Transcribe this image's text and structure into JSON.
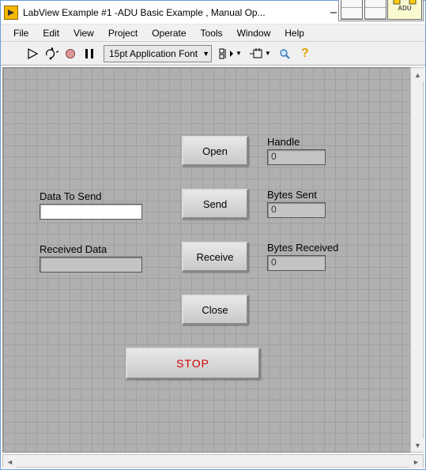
{
  "window": {
    "title": "LabView Example #1 -ADU Basic Example , Manual Op..."
  },
  "menu": {
    "file": "File",
    "edit": "Edit",
    "view": "View",
    "project": "Project",
    "operate": "Operate",
    "tools": "Tools",
    "window": "Window",
    "help": "Help"
  },
  "toolbar": {
    "font": "15pt Application Font"
  },
  "panel": {
    "data_to_send_label": "Data To Send",
    "data_to_send_value": "",
    "received_data_label": "Received Data",
    "received_data_value": "",
    "handle_label": "Handle",
    "handle_value": "0",
    "bytes_sent_label": "Bytes Sent",
    "bytes_sent_value": "0",
    "bytes_received_label": "Bytes Received",
    "bytes_received_value": "0",
    "open_btn": "Open",
    "send_btn": "Send",
    "receive_btn": "Receive",
    "close_btn": "Close",
    "stop_btn": "STOP"
  },
  "adu_label": "ADU"
}
